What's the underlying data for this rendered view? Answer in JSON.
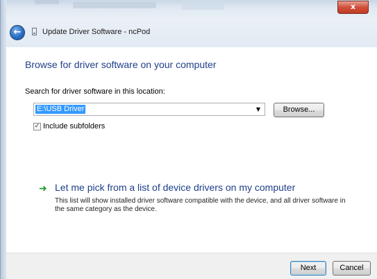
{
  "window": {
    "title": "Update Driver Software - ncPod",
    "close_label": "x"
  },
  "main": {
    "heading": "Browse for driver software on your computer",
    "search_label": "Search for driver software in this location:",
    "path_value": "E:\\USB Driver",
    "browse_label": "Browse...",
    "include_subfolders_label": "Include subfolders",
    "include_subfolders_checked": true,
    "pick_title": "Let me pick from a list of device drivers on my computer",
    "pick_description": "This list will show installed driver software compatible with the device, and all driver software in the same category as the device."
  },
  "footer": {
    "next_label": "Next",
    "cancel_label": "Cancel"
  },
  "icons": {
    "back": "back-arrow-icon",
    "device": "device-icon",
    "pick": "green-arrow-icon",
    "dropdown": "dropdown-arrow-icon",
    "check": "checkmark-icon"
  },
  "colors": {
    "heading": "#1e3f8a",
    "selection": "#3399ff",
    "pick_arrow": "#1f9d2a",
    "close_button": "#c8432c"
  }
}
